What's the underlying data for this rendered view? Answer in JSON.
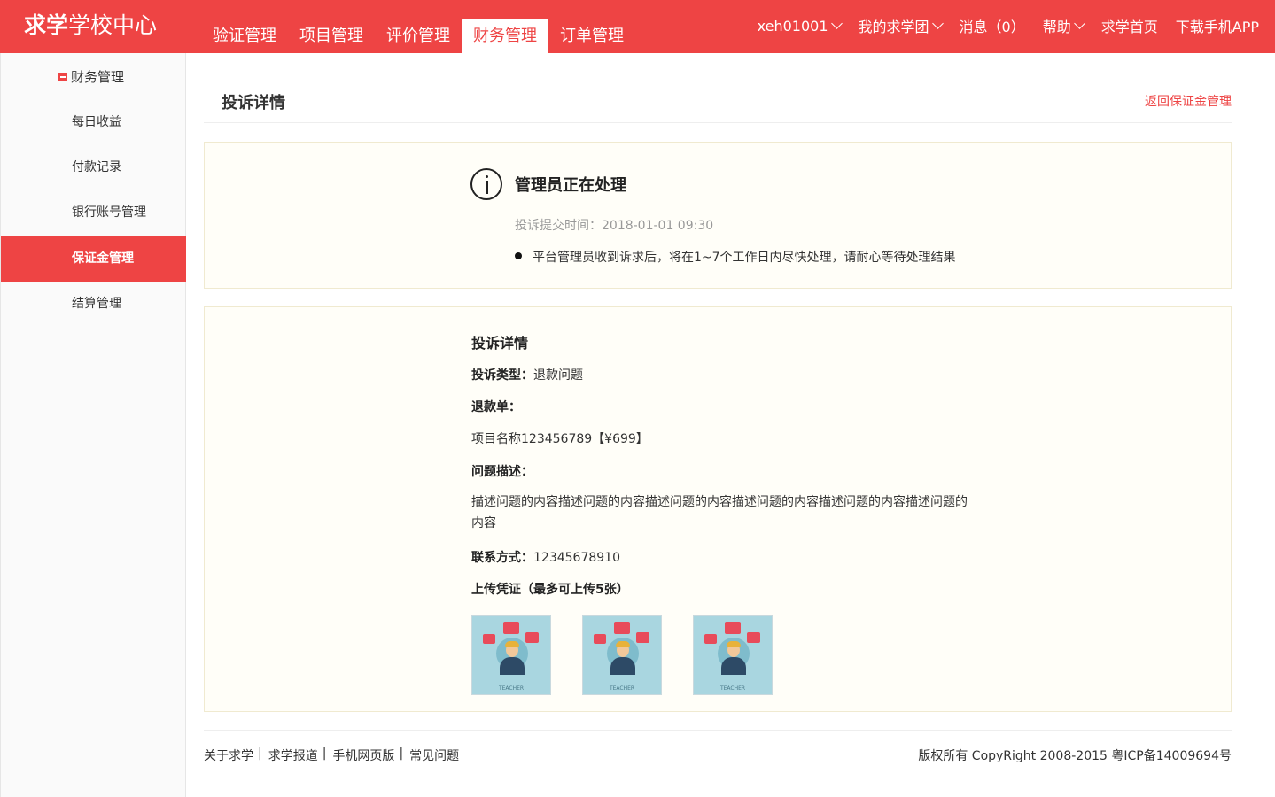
{
  "header": {
    "logo_bold": "求学",
    "logo_rest": "学校中心",
    "nav": [
      "验证管理",
      "项目管理",
      "评价管理",
      "财务管理",
      "订单管理"
    ],
    "active_nav": "财务管理",
    "user": "xeh01001",
    "my_group": "我的求学团",
    "messages": "消息（0）",
    "help": "帮助",
    "home": "求学首页",
    "download": "下载手机APP"
  },
  "sidebar": {
    "section": "财务管理",
    "items": [
      "每日收益",
      "付款记录",
      "银行账号管理",
      "保证金管理",
      "结算管理"
    ],
    "active": "保证金管理"
  },
  "page": {
    "title": "投诉详情",
    "back_link": "返回保证金管理"
  },
  "status": {
    "title": "管理员正在处理",
    "time": "投诉提交时间：2018-01-01 09:30",
    "note": "平台管理员收到诉求后，将在1~7个工作日内尽快处理，请耐心等待处理结果"
  },
  "detail": {
    "heading": "投诉详情",
    "type_label": "投诉类型：",
    "type_value": "退款问题",
    "refund_label": "退款单：",
    "refund_value": "项目名称123456789【¥699】",
    "desc_label": "问题描述：",
    "desc_value": "描述问题的内容描述问题的内容描述问题的内容描述问题的内容描述问题的内容描述问题的内容",
    "contact_label": "联系方式：",
    "contact_value": "12345678910",
    "upload_label": "上传凭证（最多可上传5张）",
    "images": [
      {
        "caption": "TEACHER"
      },
      {
        "caption": "TEACHER"
      },
      {
        "caption": "TEACHER"
      }
    ]
  },
  "footer": {
    "links": [
      "关于求学",
      "求学报道",
      "手机网页版",
      "常见问题"
    ],
    "copyright": "版权所有 CopyRight 2008-2015 粤ICP备14009694号"
  },
  "colors": {
    "brand": "#ee4444",
    "panel_bg": "#fffef8"
  }
}
